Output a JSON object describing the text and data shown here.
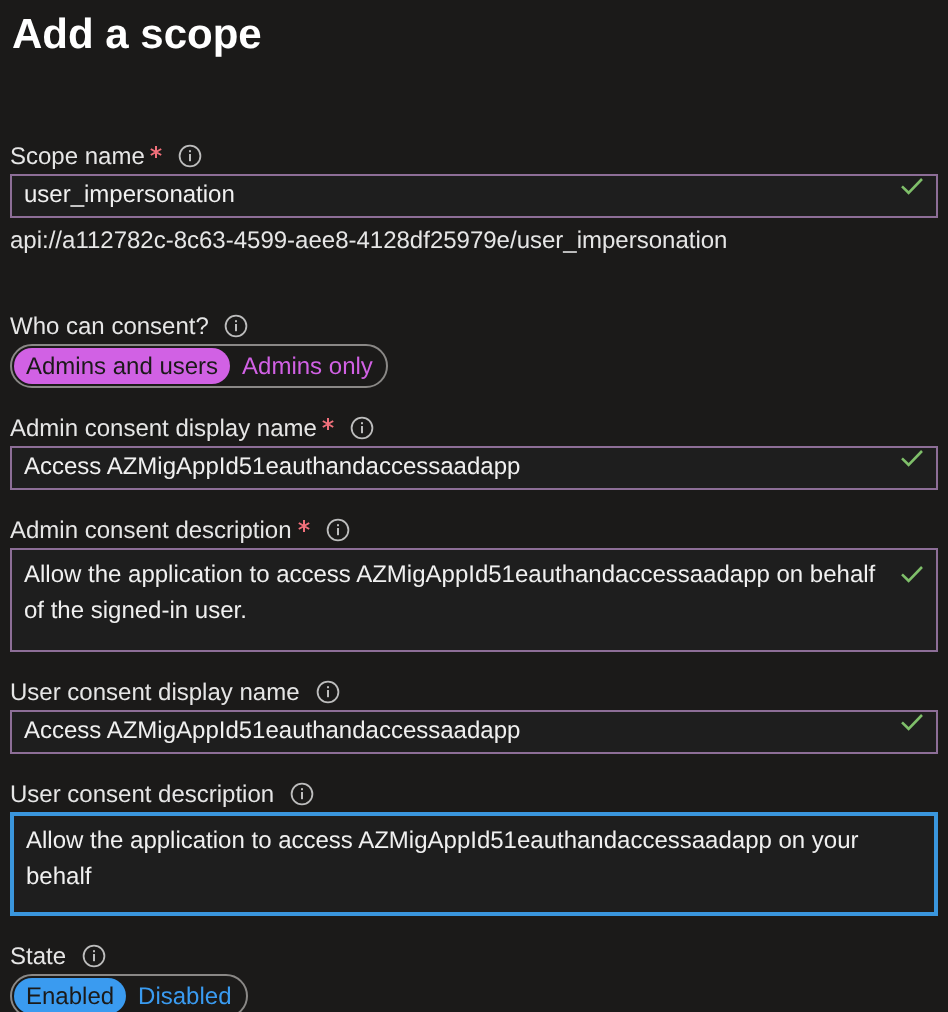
{
  "title": "Add a scope",
  "fields": [
    {
      "kind": "text",
      "label": "Scope name",
      "required": true,
      "value": "user_impersonation",
      "valid": true,
      "focused": false,
      "hint": "api://a112782c-8c63-4599-aee8-4128df25979e/user_impersonation"
    },
    {
      "kind": "toggle",
      "label": "Who can consent?",
      "required": false,
      "color": "#d161e4",
      "options": [
        {
          "label": "Admins and users",
          "selected": true
        },
        {
          "label": "Admins only",
          "selected": false
        }
      ]
    },
    {
      "kind": "text",
      "label": "Admin consent display name",
      "required": true,
      "value": "Access AZMigAppId51eauthandaccessaadapp",
      "valid": true,
      "focused": false
    },
    {
      "kind": "textarea",
      "label": "Admin consent description",
      "required": true,
      "value": "Allow the application to access AZMigAppId51eauthandaccessaadapp on behalf of the signed-in user.",
      "valid": true,
      "focused": false
    },
    {
      "kind": "text",
      "label": "User consent display name",
      "required": false,
      "value": "Access AZMigAppId51eauthandaccessaadapp",
      "valid": true,
      "focused": false
    },
    {
      "kind": "textarea",
      "label": "User consent description",
      "required": false,
      "value": "Allow the application to access AZMigAppId51eauthandaccessaadapp on your behalf",
      "valid": false,
      "focused": true
    },
    {
      "kind": "toggle",
      "label": "State",
      "required": false,
      "color": "#3a9bf0",
      "options": [
        {
          "label": "Enabled",
          "selected": true
        },
        {
          "label": "Disabled",
          "selected": false
        }
      ]
    }
  ]
}
